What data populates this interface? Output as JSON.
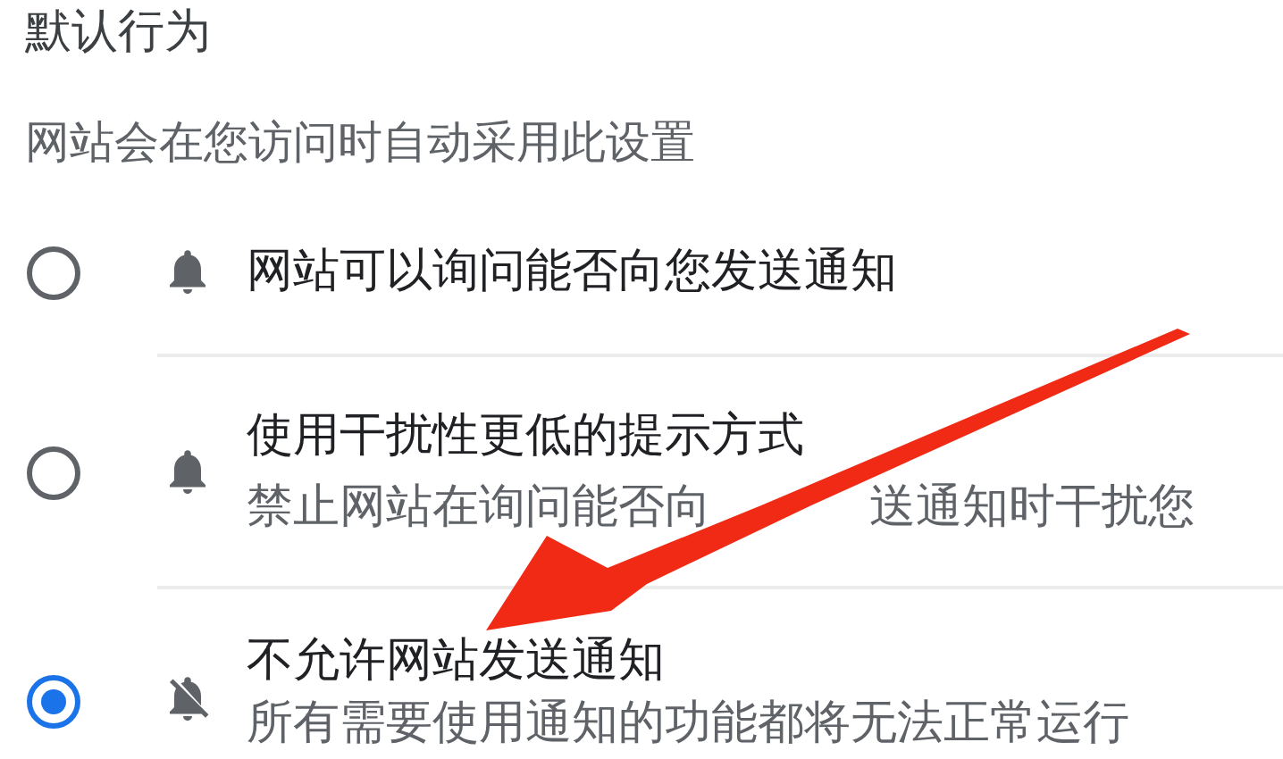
{
  "section_title": "默认行为",
  "description": "网站会在您访问时自动采用此设置",
  "options": [
    {
      "title": "网站可以询问能否向您发送通知",
      "kind": "bell",
      "selected": false
    },
    {
      "title": "使用干扰性更低的提示方式",
      "subtitle_parts": [
        "禁止网站在询问能否向",
        "送通知时干扰您"
      ],
      "kind": "bell",
      "selected": false
    },
    {
      "title": "不允许网站发送通知",
      "subtitle_parts": [
        "所有需要使用通知的功能都将无法正常运行"
      ],
      "kind": "bell-off",
      "selected": true
    }
  ]
}
